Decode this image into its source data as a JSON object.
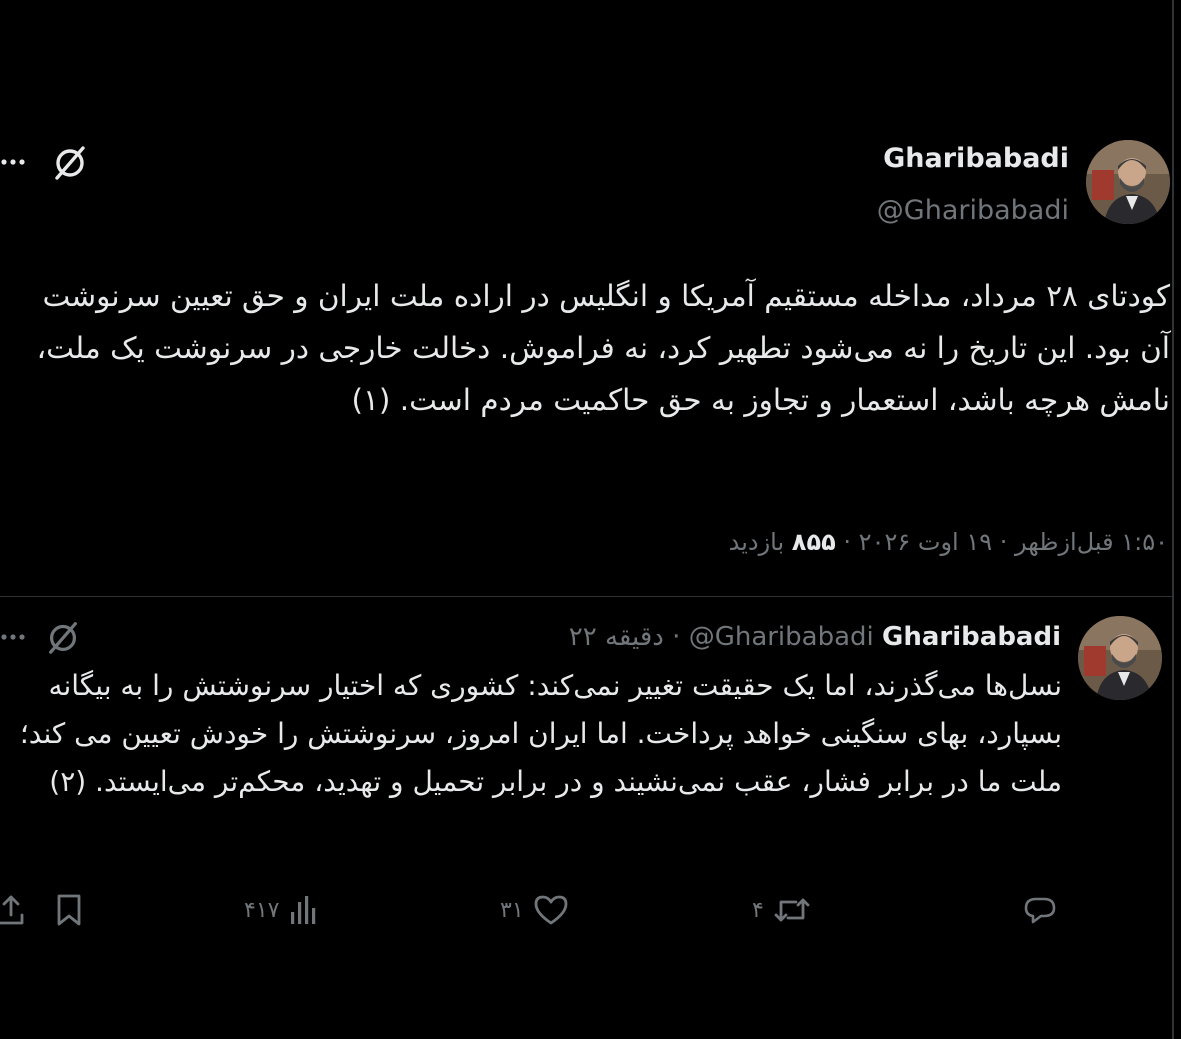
{
  "main_tweet": {
    "author_name": "Gharibabadi",
    "author_handle": "@Gharibabadi",
    "text": "کودتای ۲۸ مرداد، مداخله مستقیم آمریکا و انگلیس در اراده ملت ایران و حق تعیین سرنوشت آن بود. این تاریخ را نه می‌شود تطهیر کرد، نه فراموش. دخالت خارجی در سرنوشت یک ملت، نامش هرچه باشد، استعمار و تجاوز به حق حاکمیت مردم است. (۱)",
    "time": "۱:۵۰ قبل‌ازظهر",
    "date": "۱۹ اوت ۲۰۲۶",
    "views_count": "۸۵۵",
    "views_label": "بازدید",
    "separator": "·"
  },
  "reply_tweet": {
    "author_name": "Gharibabadi",
    "author_handle": "@Gharibabadi",
    "separator": "·",
    "time_ago": "۲۲ دقیقه",
    "text": "نسل‌ها می‌گذرند، اما یک حقیقت تغییر نمی‌کند: کشوری که اختیار سرنوشتش را به بیگانه بسپارد، بهای سنگینی خواهد پرداخت. اما ایران امروز، سرنوشتش را خودش تعیین می کند؛ ملت ما در برابر فشار، عقب نمی‌نشیند و در برابر تحمیل و تهدید، محکم‌تر می‌ایستد. (۲)",
    "actions": {
      "reply_count": "",
      "retweet_count": "۴",
      "like_count": "۳۱",
      "views_count": "۴۱۷"
    }
  },
  "icons": {
    "more": "more-icon",
    "grok": "grok-icon",
    "reply": "reply-icon",
    "retweet": "retweet-icon",
    "like": "heart-icon",
    "views": "views-icon",
    "bookmark": "bookmark-icon",
    "share": "share-icon"
  },
  "colors": {
    "background": "#000000",
    "text_primary": "#e7e9ea",
    "text_secondary": "#71767b",
    "border": "#2f3336"
  }
}
